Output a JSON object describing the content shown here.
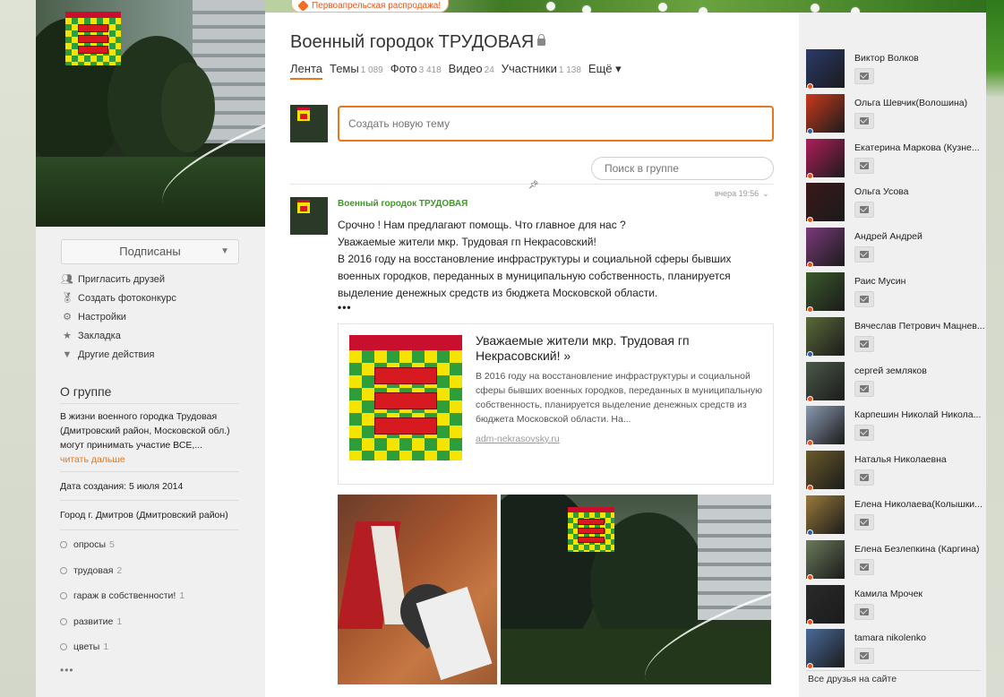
{
  "promo": {
    "label": "Первоапрельская распродажа!"
  },
  "group": {
    "title": "Военный городок ТРУДОВАЯ",
    "subscribe_label": "Подписаны",
    "actions": [
      {
        "icon": "users-icon",
        "label": "Пригласить друзей"
      },
      {
        "icon": "medal-icon",
        "label": "Создать фотоконкурс"
      },
      {
        "icon": "gear-icon",
        "label": "Настройки"
      },
      {
        "icon": "star-icon",
        "label": "Закладка"
      },
      {
        "icon": "triangle-down-icon",
        "label": "Другие действия"
      }
    ],
    "about_title": "О группе",
    "about_text": "В жизни военного городка Трудовая (Дмитровский район, Московской обл.) могут  принимать участие ВСЕ,...",
    "read_more": "читать дальше",
    "created": "Дата создания: 5 июля 2014",
    "city": "Город г. Дмитров (Дмитровский район)",
    "topics": [
      {
        "label": "опросы",
        "count": "5"
      },
      {
        "label": "трудовая",
        "count": "2"
      },
      {
        "label": "гараж в собственности!",
        "count": "1"
      },
      {
        "label": "развитие",
        "count": "1"
      },
      {
        "label": "цветы",
        "count": "1"
      }
    ],
    "more_dots": "•••"
  },
  "tabs": [
    {
      "label": "Лента",
      "count": ""
    },
    {
      "label": "Темы",
      "count": "1 089"
    },
    {
      "label": "Фото",
      "count": "3 418"
    },
    {
      "label": "Видео",
      "count": "24"
    },
    {
      "label": "Участники",
      "count": "1 138"
    },
    {
      "label": "Ещё ▾",
      "count": ""
    }
  ],
  "new_topic": {
    "placeholder": "Создать новую тему"
  },
  "search": {
    "placeholder": "Поиск в группе"
  },
  "post": {
    "time": "вчера 19:56",
    "author": "Военный городок ТРУДОВАЯ",
    "lines": [
      "Срочно !  Нам предлагают помощь. Что главное для нас ?",
      "Уважаемые жители мкр. Трудовая гп Некрасовский!",
      "В 2016 году на восстановление инфраструктуры и социальной сферы бывших военных городков, переданных в муниципальную собственность, планируется выделение денежных средств из бюджета Московской области."
    ],
    "dots": "•••",
    "link": {
      "title": "Уважаемые жители мкр. Трудовая гп Некрасовский! »",
      "desc": "В 2016 году на восстановление инфраструктуры и социальной сферы бывших военных городков, переданных в муниципальную собственность, планируется выделение денежных средств из бюджета Московской области. На...",
      "url": "adm-nekrasovsky.ru"
    }
  },
  "friends": [
    {
      "name": "Виктор Волков",
      "color": "#2a3a6a",
      "status": "orange"
    },
    {
      "name": "Ольга Шевчик(Волошина)",
      "color": "#c83a1e",
      "status": "blue"
    },
    {
      "name": "Екатерина Маркова (Кузне...",
      "color": "#b01d5a",
      "status": "orange"
    },
    {
      "name": "Ольга Усова",
      "color": "#3a1818",
      "status": "orange"
    },
    {
      "name": "Андрей Андрей",
      "color": "#7a3a7a",
      "status": "orange"
    },
    {
      "name": "Раис Мусин",
      "color": "#3a5a2a",
      "status": "orange"
    },
    {
      "name": "Вячеслав Петрович Мацнев...",
      "color": "#5a6a3a",
      "status": "blue"
    },
    {
      "name": "сергей земляков",
      "color": "#4a5a4a",
      "status": "orange"
    },
    {
      "name": "Карпешин Николай Никола...",
      "color": "#8a9ab0",
      "status": "orange"
    },
    {
      "name": "Наталья Николаевна",
      "color": "#6a5a2a",
      "status": "orange"
    },
    {
      "name": "Елена Николаева(Колышки...",
      "color": "#9a7a3a",
      "status": "blue"
    },
    {
      "name": "Елена Безлепкина (Каргина)",
      "color": "#6a7a5a",
      "status": "orange"
    },
    {
      "name": "Камила Мрочек",
      "color": "#2a2a2a",
      "status": "orange"
    },
    {
      "name": "tamara nikolenko",
      "color": "#4a6a9a",
      "status": "orange"
    }
  ],
  "all_friends": "Все друзья на сайте"
}
